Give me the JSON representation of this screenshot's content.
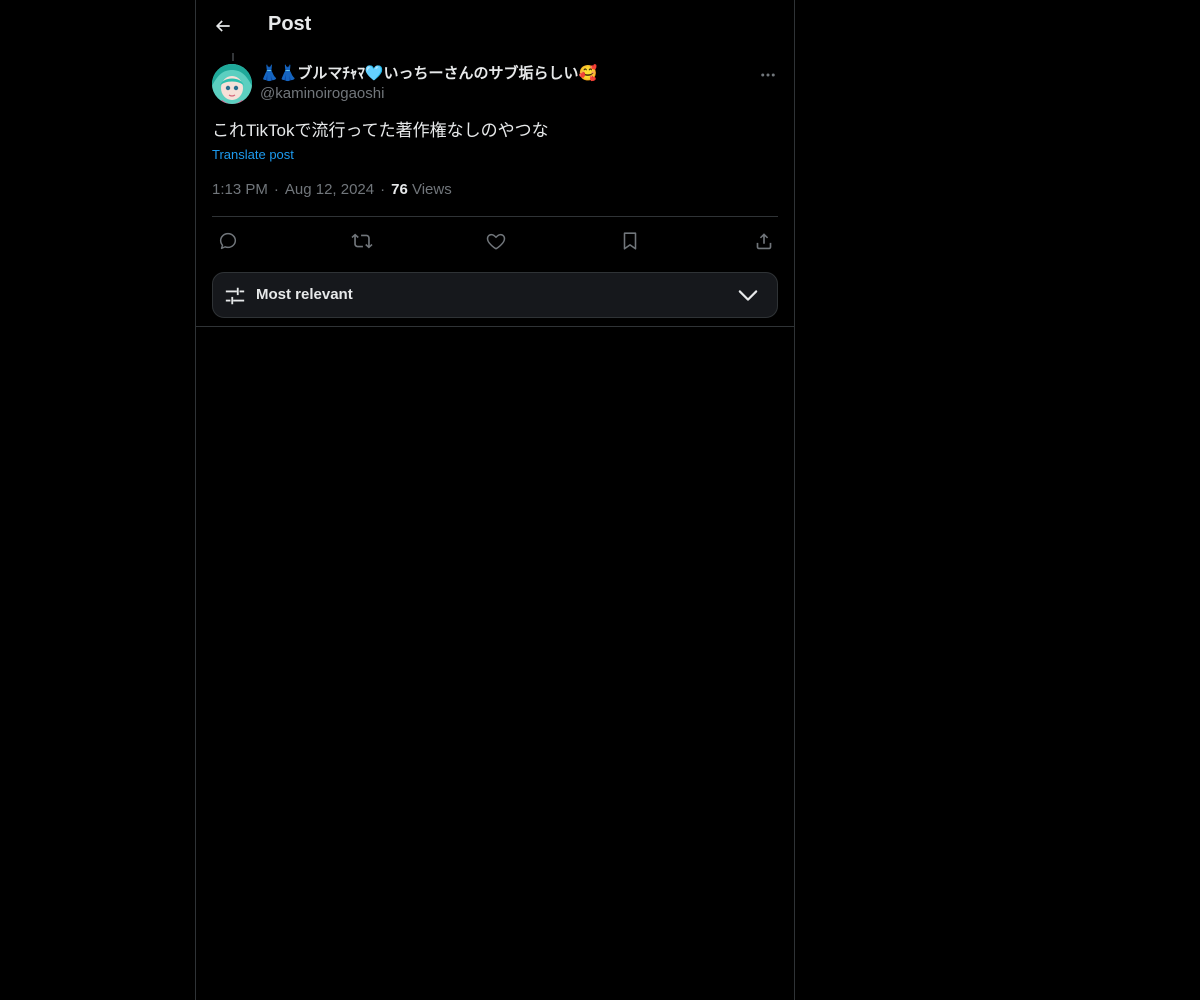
{
  "header": {
    "title": "Post",
    "back_icon": "arrow-left-icon"
  },
  "post": {
    "author": {
      "display_name": "👗👗ブルマﾁｬﾏ🩵いっちーさんのサブ垢らしい🥰",
      "handle": "@kaminoirogaoshi",
      "avatar_icon": "avatar-anime-girl"
    },
    "text": "これTikTokで流行ってた著作権なしのやつな",
    "translate_label": "Translate post",
    "time": "1:13 PM",
    "separator": "·",
    "date": "Aug 12, 2024",
    "views_count": "76",
    "views_label": "Views"
  },
  "actions": {
    "reply_icon": "reply-icon",
    "repost_icon": "repost-icon",
    "like_icon": "heart-icon",
    "bookmark_icon": "bookmark-icon",
    "share_icon": "share-icon",
    "more_icon": "more-icon"
  },
  "sort": {
    "label": "Most relevant",
    "icon": "sliders-icon",
    "chevron": "chevron-down-icon"
  },
  "colors": {
    "background": "#000000",
    "text_primary": "#e7e9ea",
    "text_secondary": "#71767b",
    "accent": "#1d9bf0",
    "border": "#2f3336",
    "card": "#16181c"
  }
}
